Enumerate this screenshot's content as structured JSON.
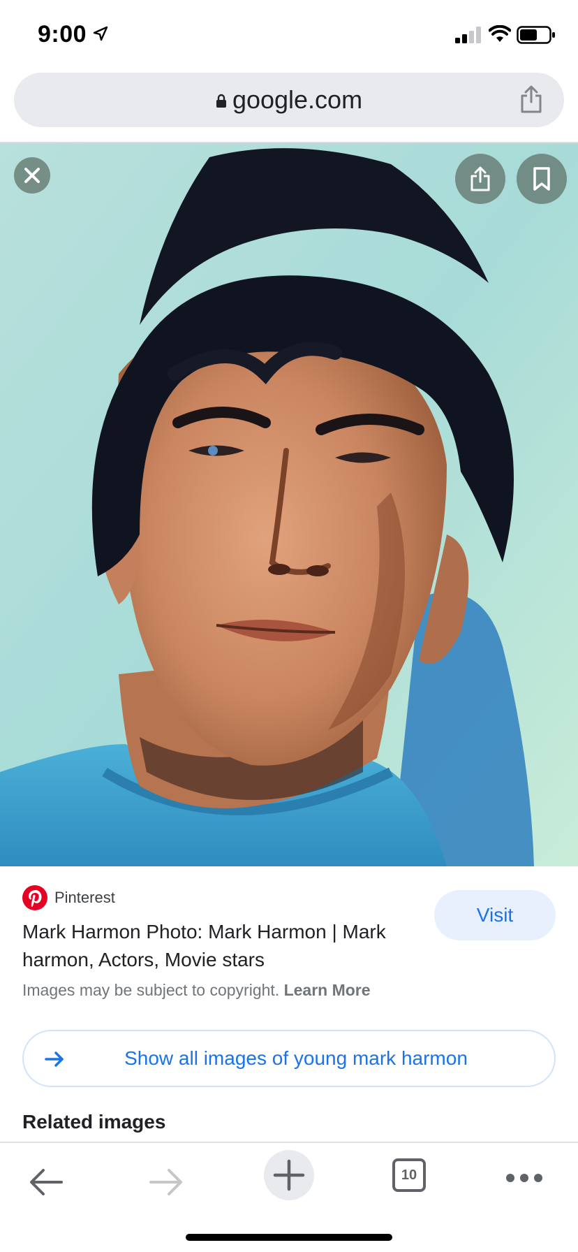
{
  "status_bar": {
    "time": "9:00"
  },
  "address_bar": {
    "url": "google.com"
  },
  "result": {
    "source": "Pinterest",
    "title": "Mark Harmon Photo: Mark Harmon | Mark harmon, Actors, Movie stars",
    "copyright_text": "Images may be subject to copyright.",
    "learn_more": "Learn More",
    "visit_label": "Visit",
    "show_all_label": "Show all images of young mark harmon",
    "related_heading": "Related images"
  },
  "toolbar": {
    "tab_count": "10"
  },
  "icons": {
    "location": "location-arrow-icon",
    "lock": "lock-icon",
    "share": "share-icon",
    "close": "close-icon",
    "bookmark": "bookmark-icon",
    "pinterest": "pinterest-logo-icon",
    "arrow": "arrow-right-icon",
    "back": "back-arrow-icon",
    "forward": "forward-arrow-icon",
    "new_tab": "plus-icon",
    "more": "more-dots-icon"
  },
  "colors": {
    "accent": "#1a73e8",
    "visit_bg": "#e8f0fe",
    "pinterest_red": "#e60023",
    "address_bg": "#e8eaed"
  }
}
